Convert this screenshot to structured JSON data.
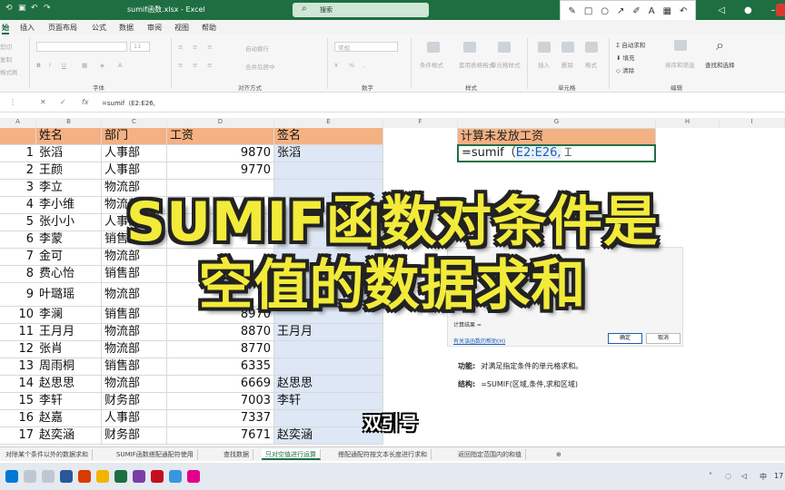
{
  "title_bar": {
    "doc_title": "sumif函数.xlsx  -  Excel",
    "search_label": "搜索"
  },
  "menu_tabs": [
    "始",
    "插入",
    "页面布局",
    "公式",
    "数据",
    "审阅",
    "视图",
    "帮助"
  ],
  "ribbon": {
    "clipboard_items": [
      "剪切",
      "复制",
      "格式刷"
    ],
    "groups": [
      "字体",
      "对齐方式",
      "数字",
      "样式",
      "单元格",
      "编辑"
    ],
    "font_size": "11",
    "alignment_items": [
      "自动换行",
      "合并后居中"
    ],
    "number_format": "常规",
    "style_items": [
      "条件格式",
      "套用表格格式",
      "单元格样式"
    ],
    "cell_items": [
      "插入",
      "删除",
      "格式"
    ],
    "edit_items": [
      "自动求和",
      "填充",
      "清除",
      "排序和筛选",
      "查找和选择"
    ]
  },
  "formula_bar": {
    "fx": "fx",
    "content": "=sumif（E2:E26,"
  },
  "columns": [
    "A",
    "B",
    "C",
    "D",
    "E",
    "F",
    "G",
    "H",
    "I"
  ],
  "headers": {
    "name": "姓名",
    "dept": "部门",
    "salary": "工资",
    "sign": "签名"
  },
  "rows": [
    {
      "n": "1",
      "name": "张滔",
      "dept": "人事部",
      "salary": "9870",
      "sign": "张滔"
    },
    {
      "n": "2",
      "name": "王颜",
      "dept": "人事部",
      "salary": "9770",
      "sign": ""
    },
    {
      "n": "3",
      "name": "李立",
      "dept": "物流部",
      "salary": "",
      "sign": ""
    },
    {
      "n": "4",
      "name": "李小维",
      "dept": "物流部",
      "salary": "",
      "sign": ""
    },
    {
      "n": "5",
      "name": "张小小",
      "dept": "人事部",
      "salary": "",
      "sign": ""
    },
    {
      "n": "6",
      "name": "李蒙",
      "dept": "销售部",
      "salary": "",
      "sign": ""
    },
    {
      "n": "7",
      "name": "金可",
      "dept": "物流部",
      "salary": "",
      "sign": ""
    },
    {
      "n": "8",
      "name": "费心怡",
      "dept": "销售部",
      "salary": "",
      "sign": ""
    },
    {
      "n": "9",
      "name": "叶璐瑶",
      "dept": "物流部",
      "salary": "",
      "sign": ""
    },
    {
      "n": "10",
      "name": "李澜",
      "dept": "销售部",
      "salary": "8970",
      "sign": ""
    },
    {
      "n": "11",
      "name": "王月月",
      "dept": "物流部",
      "salary": "8870",
      "sign": "王月月"
    },
    {
      "n": "12",
      "name": "张肖",
      "dept": "物流部",
      "salary": "8770",
      "sign": ""
    },
    {
      "n": "13",
      "name": "周雨桐",
      "dept": "销售部",
      "salary": "6335",
      "sign": ""
    },
    {
      "n": "14",
      "name": "赵思思",
      "dept": "物流部",
      "salary": "6669",
      "sign": "赵思思"
    },
    {
      "n": "15",
      "name": "李轩",
      "dept": "财务部",
      "salary": "7003",
      "sign": "李轩"
    },
    {
      "n": "16",
      "name": "赵嘉",
      "dept": "人事部",
      "salary": "7337",
      "sign": ""
    },
    {
      "n": "17",
      "name": "赵奕涵",
      "dept": "财务部",
      "salary": "7671",
      "sign": "赵奕涵"
    }
  ],
  "g_column": {
    "header": "计算未发放工资",
    "formula_prefix": "=sumif（",
    "formula_range": "E2:E26,"
  },
  "dialog": {
    "result_label": "计算结果 =",
    "help_link": "有关该函数的帮助(H)",
    "ok": "确定",
    "cancel": "取消"
  },
  "explain": {
    "func_label": "功能:",
    "func_text": "对满足指定条件的单元格求和。",
    "syntax_label": "结构:",
    "syntax_text": "=SUMIF(区域,条件,求和区域)"
  },
  "overlay": {
    "line1": "SUMIF函数对条件是",
    "line2": "空值的数据求和",
    "subtitle": "双引号"
  },
  "sheet_tabs": [
    "对除某个条件以外的数据求和",
    "SUMIF函数搭配通配符使用",
    "查找数据",
    "只对空值进行运算",
    "搭配通配符按文本长度进行求和",
    "返回指定范围内的和值"
  ],
  "active_sheet_index": 3,
  "tray": {
    "lang": "中",
    "time": "17"
  }
}
